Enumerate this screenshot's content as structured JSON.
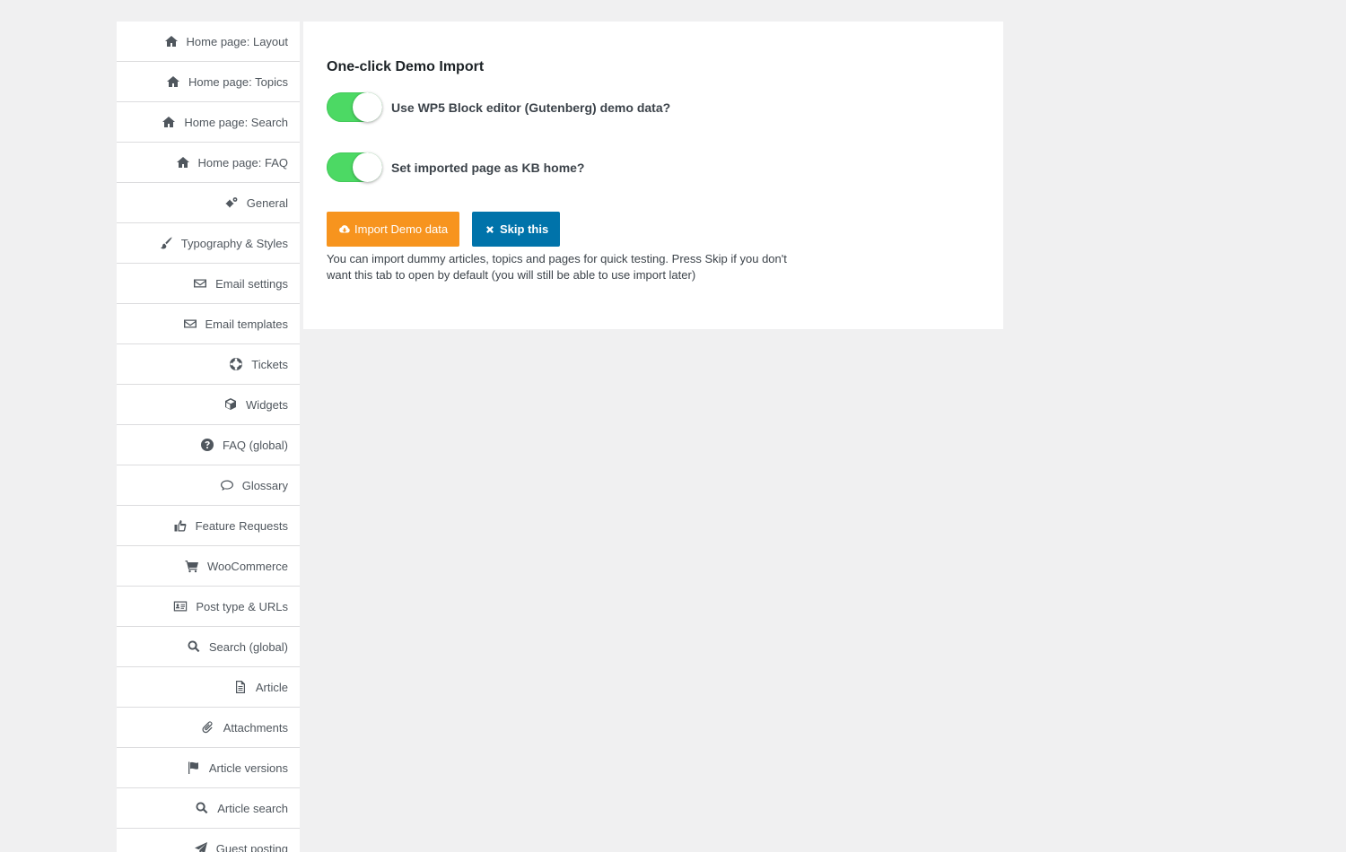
{
  "sidebar": {
    "items": [
      {
        "label": "Home page: Layout",
        "icon": "home-icon"
      },
      {
        "label": "Home page: Topics",
        "icon": "home-icon"
      },
      {
        "label": "Home page: Search",
        "icon": "home-icon"
      },
      {
        "label": "Home page: FAQ",
        "icon": "home-icon"
      },
      {
        "label": "General",
        "icon": "gears-icon"
      },
      {
        "label": "Typography & Styles",
        "icon": "paintbrush-icon"
      },
      {
        "label": "Email settings",
        "icon": "envelope-icon"
      },
      {
        "label": "Email templates",
        "icon": "envelope-icon"
      },
      {
        "label": "Tickets",
        "icon": "lifebuoy-icon"
      },
      {
        "label": "Widgets",
        "icon": "cube-icon"
      },
      {
        "label": "FAQ (global)",
        "icon": "question-circle-icon"
      },
      {
        "label": "Glossary",
        "icon": "speech-bubble-icon"
      },
      {
        "label": "Feature Requests",
        "icon": "thumbs-up-icon"
      },
      {
        "label": "WooCommerce",
        "icon": "cart-icon"
      },
      {
        "label": "Post type & URLs",
        "icon": "id-card-icon"
      },
      {
        "label": "Search (global)",
        "icon": "search-icon"
      },
      {
        "label": "Article",
        "icon": "document-icon"
      },
      {
        "label": "Attachments",
        "icon": "paperclip-icon"
      },
      {
        "label": "Article versions",
        "icon": "flag-icon"
      },
      {
        "label": "Article search",
        "icon": "search-icon"
      },
      {
        "label": "Guest posting",
        "icon": "paper-plane-icon"
      }
    ]
  },
  "panel": {
    "title": "One-click Demo Import",
    "toggles": [
      {
        "label": "Use WP5 Block editor (Gutenberg) demo data?",
        "on": true
      },
      {
        "label": "Set imported page as KB home?",
        "on": true
      }
    ],
    "import_button": "Import Demo data",
    "skip_button": "Skip this",
    "help_text": "You can import dummy articles, topics and pages for quick testing. Press Skip if you don't want this tab to open by default (you will still be able to use import later)"
  },
  "colors": {
    "toggle_on": "#4cd964",
    "import_button": "#f7941e",
    "skip_button": "#0073aa",
    "page_background": "#f0f0f1"
  }
}
